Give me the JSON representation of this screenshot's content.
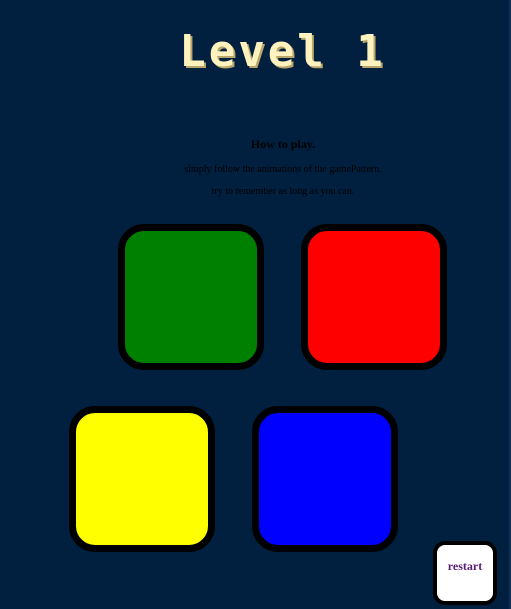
{
  "header": {
    "level_title": "Level 1"
  },
  "instructions": {
    "title": "How to play.",
    "line1": "simply follow the animations of the gamePattern.",
    "line2": "try to remember as long as you can."
  },
  "pads": [
    {
      "id": "green",
      "color": "#008000"
    },
    {
      "id": "red",
      "color": "#ff0000"
    },
    {
      "id": "yellow",
      "color": "#ffff00"
    },
    {
      "id": "blue",
      "color": "#0000ff"
    }
  ],
  "controls": {
    "restart_label": "restart"
  },
  "colors": {
    "background": "#011f3f",
    "title": "#fef2bf",
    "pad_border": "#000000",
    "restart_text": "#5a1a7a"
  }
}
